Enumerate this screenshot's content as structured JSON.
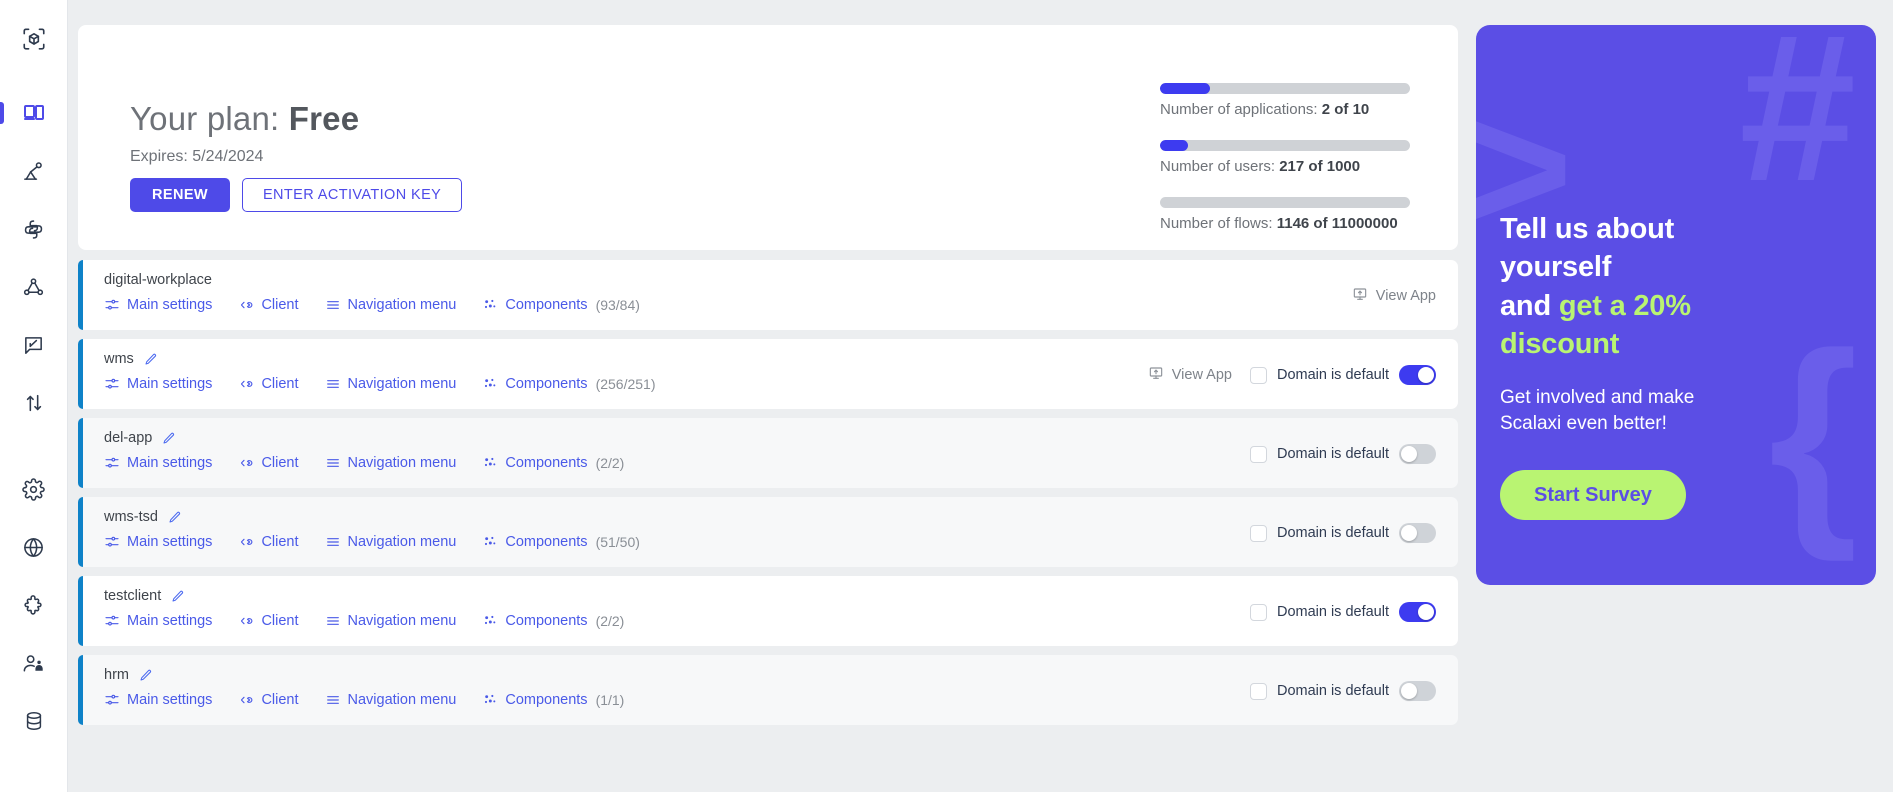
{
  "sidebar": {
    "logo_icon": "cube-logo-icon",
    "items": [
      {
        "icon": "apps-layout-icon",
        "name": "sidebar-item-applications",
        "active": true
      },
      {
        "icon": "robot-arm-icon",
        "name": "sidebar-item-automation",
        "active": false
      },
      {
        "icon": "python-integration-icon",
        "name": "sidebar-item-integrations",
        "active": false
      },
      {
        "icon": "flow-nodes-icon",
        "name": "sidebar-item-flows",
        "active": false
      },
      {
        "icon": "message-edit-icon",
        "name": "sidebar-item-forms",
        "active": false
      },
      {
        "icon": "transfer-arrows-icon",
        "name": "sidebar-item-transfer",
        "active": false
      },
      {
        "icon": "gear-icon",
        "name": "sidebar-item-settings",
        "active": false
      },
      {
        "icon": "globe-icon",
        "name": "sidebar-item-domains",
        "active": false
      },
      {
        "icon": "puzzle-icon",
        "name": "sidebar-item-plugins",
        "active": false
      },
      {
        "icon": "users-icon",
        "name": "sidebar-item-users",
        "active": false
      },
      {
        "icon": "database-icon",
        "name": "sidebar-item-database",
        "active": false
      }
    ]
  },
  "plan": {
    "title_prefix": "Your plan: ",
    "title_value": "Free",
    "expires_label": "Expires: 5/24/2024",
    "renew_label": "RENEW",
    "activation_label": "ENTER ACTIVATION KEY",
    "accent_color": "#4e4ae8",
    "stats": [
      {
        "label_prefix": "Number of applications: ",
        "label_value": "2 of 10",
        "percent": 20,
        "current": 2,
        "limit": 10
      },
      {
        "label_prefix": "Number of users: ",
        "label_value": "217 of 1000",
        "percent": 11,
        "current": 217,
        "limit": 1000
      },
      {
        "label_prefix": "Number of flows: ",
        "label_value": "1146 of 11000000",
        "percent": 0,
        "current": 1146,
        "limit": 11000000
      }
    ]
  },
  "row_links": {
    "main_settings": "Main settings",
    "client": "Client",
    "navigation_menu": "Navigation menu",
    "components": "Components",
    "view_app": "View App",
    "domain_is_default": "Domain is default"
  },
  "apps": [
    {
      "name": "digital-workplace",
      "components": "(93/84)",
      "editable": false,
      "view_app": true,
      "has_domain": false,
      "toggle_on": false,
      "bg": "white"
    },
    {
      "name": "wms",
      "components": "(256/251)",
      "editable": true,
      "view_app": true,
      "has_domain": true,
      "toggle_on": true,
      "bg": "white"
    },
    {
      "name": "del-app",
      "components": "(2/2)",
      "editable": true,
      "view_app": false,
      "has_domain": true,
      "toggle_on": false,
      "bg": "gray"
    },
    {
      "name": "wms-tsd",
      "components": "(51/50)",
      "editable": true,
      "view_app": false,
      "has_domain": true,
      "toggle_on": false,
      "bg": "gray"
    },
    {
      "name": "testclient",
      "components": "(2/2)",
      "editable": true,
      "view_app": false,
      "has_domain": true,
      "toggle_on": true,
      "bg": "white"
    },
    {
      "name": "hrm",
      "components": "(1/1)",
      "editable": true,
      "view_app": false,
      "has_domain": true,
      "toggle_on": false,
      "bg": "gray"
    }
  ],
  "promo": {
    "head_line1": "Tell us about",
    "head_line2": "yourself",
    "head_line3_plain": "and ",
    "head_line3_hl": "get a 20%",
    "head_line4_hl": "discount",
    "sub_line1": "Get involved and make",
    "sub_line2": "Scalaxi even better!",
    "button_label": "Start Survey",
    "bg_color": "#5b4ee5",
    "accent_color": "#b9f472",
    "deco_hash": "#",
    "deco_gt": ">",
    "deco_brace": "{"
  }
}
